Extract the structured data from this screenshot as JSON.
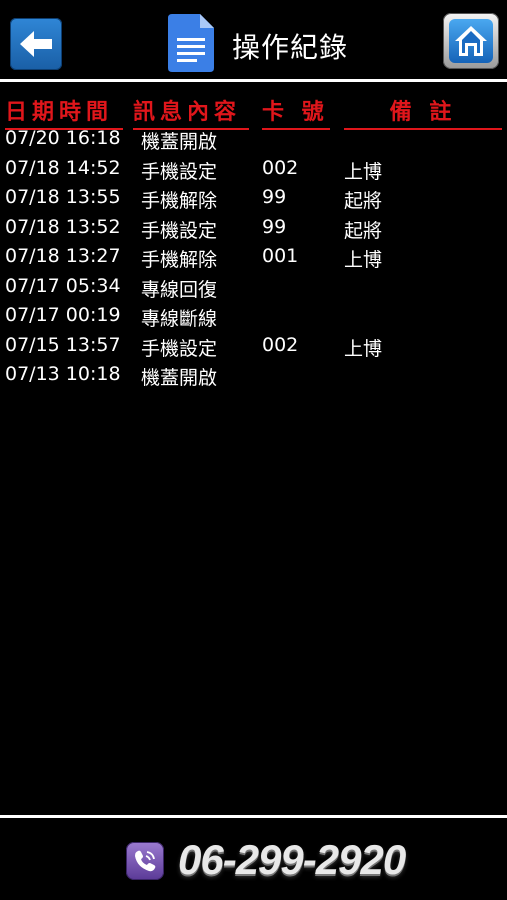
{
  "header": {
    "title": "操作紀錄",
    "back_icon": "arrow-left-icon",
    "doc_icon": "document-icon",
    "home_icon": "home-icon"
  },
  "columns": {
    "time": "日期時間",
    "message": "訊息內容",
    "card": "卡 號",
    "note": "備 註"
  },
  "records": [
    {
      "time": "07/20 16:18",
      "message": "機蓋開啟",
      "card": "",
      "note": ""
    },
    {
      "time": "07/18 14:52",
      "message": "手機設定",
      "card": "002",
      "note": "上博"
    },
    {
      "time": "07/18 13:55",
      "message": "手機解除",
      "card": "99",
      "note": "起將"
    },
    {
      "time": "07/18 13:52",
      "message": "手機設定",
      "card": "99",
      "note": "起將"
    },
    {
      "time": "07/18 13:27",
      "message": "手機解除",
      "card": "001",
      "note": "上博"
    },
    {
      "time": "07/17 05:34",
      "message": "專線回復",
      "card": "",
      "note": ""
    },
    {
      "time": "07/17 00:19",
      "message": "專線斷線",
      "card": "",
      "note": ""
    },
    {
      "time": "07/15 13:57",
      "message": "手機設定",
      "card": "002",
      "note": "上博"
    },
    {
      "time": "07/13 10:18",
      "message": "機蓋開啟",
      "card": "",
      "note": ""
    }
  ],
  "footer": {
    "phone_icon": "phone-icon",
    "phone_number": "06-299-2920"
  },
  "colors": {
    "header_red": "#e0161b",
    "back_blue": "#1a5fa6",
    "phone_purple": "#5b3a97"
  }
}
